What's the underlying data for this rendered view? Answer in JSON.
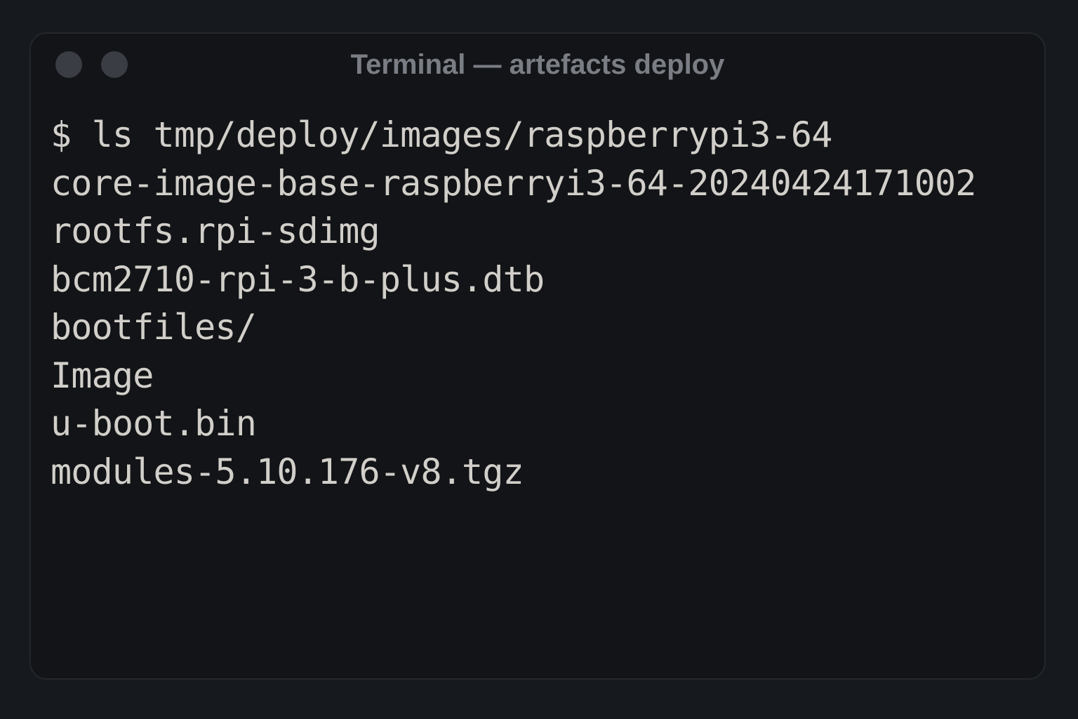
{
  "window": {
    "title": "Terminal — artefacts deploy",
    "buttons": [
      "close",
      "minimize"
    ]
  },
  "terminal": {
    "prompt": "$ ",
    "command": "ls tmp/deploy/images/raspberrypi3-64",
    "output": [
      "core-image-base-raspberryi3-64-20240424171002",
      "rootfs.rpi-sdimg",
      "bcm2710-rpi-3-b-plus.dtb",
      "bootfiles/",
      "Image",
      "u-boot.bin",
      "modules-5.10.176-v8.tgz"
    ]
  },
  "colors": {
    "page_background": "#16191d",
    "window_background": "#121417",
    "text": "#d2cfca",
    "title_text": "#7a7e84",
    "window_button": "#3a3e44"
  }
}
